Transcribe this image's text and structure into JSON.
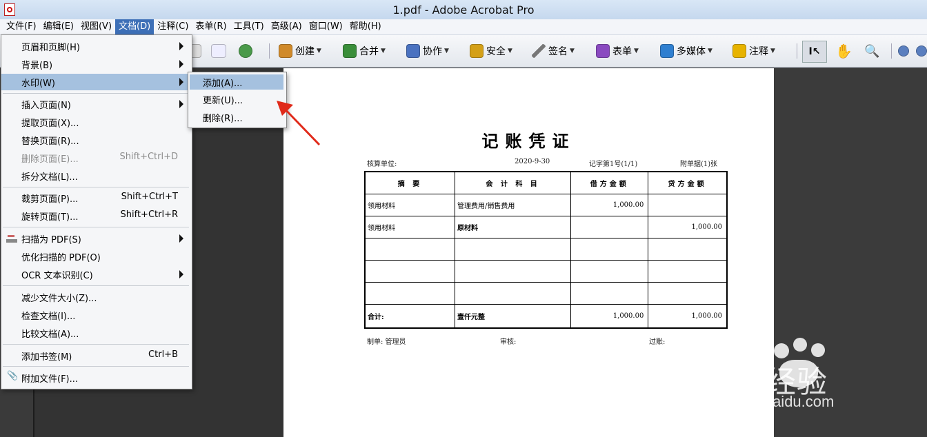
{
  "window": {
    "title": "1.pdf - Adobe Acrobat Pro"
  },
  "menubar": {
    "items": [
      "文件(F)",
      "编辑(E)",
      "视图(V)",
      "文档(D)",
      "注释(C)",
      "表单(R)",
      "工具(T)",
      "高级(A)",
      "窗口(W)",
      "帮助(H)"
    ],
    "active": "文档(D)"
  },
  "toolbar": {
    "buttons": [
      {
        "label": "创建",
        "icon": "create-pdf-icon",
        "color": "#d08a2a"
      },
      {
        "label": "合并",
        "icon": "combine-icon",
        "color": "#3a8e3a"
      },
      {
        "label": "协作",
        "icon": "collaborate-icon",
        "color": "#4a72c0"
      },
      {
        "label": "安全",
        "icon": "lock-icon",
        "color": "#d4a017"
      },
      {
        "label": "签名",
        "icon": "pen-icon",
        "color": "#6a6a6a"
      },
      {
        "label": "表单",
        "icon": "form-icon",
        "color": "#8a4ac0"
      },
      {
        "label": "多媒体",
        "icon": "multimedia-icon",
        "color": "#2f7fd0"
      },
      {
        "label": "注释",
        "icon": "comment-icon",
        "color": "#e7b300"
      }
    ]
  },
  "document_menu": {
    "items": [
      {
        "label": "页眉和页脚(H)",
        "shortcut": "",
        "submenu": true,
        "disabled": false
      },
      {
        "label": "背景(B)",
        "shortcut": "",
        "submenu": true,
        "disabled": false
      },
      {
        "label": "水印(W)",
        "shortcut": "",
        "submenu": true,
        "disabled": false
      },
      {
        "label": "插入页面(N)",
        "shortcut": "",
        "submenu": true,
        "disabled": false
      },
      {
        "label": "提取页面(X)...",
        "shortcut": "",
        "submenu": false,
        "disabled": false
      },
      {
        "label": "替换页面(R)...",
        "shortcut": "",
        "submenu": false,
        "disabled": false
      },
      {
        "label": "删除页面(E)...",
        "shortcut": "Shift+Ctrl+D",
        "submenu": false,
        "disabled": true
      },
      {
        "label": "拆分文档(L)...",
        "shortcut": "",
        "submenu": false,
        "disabled": false
      },
      {
        "label": "裁剪页面(P)...",
        "shortcut": "Shift+Ctrl+T",
        "submenu": false,
        "disabled": false
      },
      {
        "label": "旋转页面(T)...",
        "shortcut": "Shift+Ctrl+R",
        "submenu": false,
        "disabled": false
      },
      {
        "label": "扫描为 PDF(S)",
        "shortcut": "",
        "submenu": true,
        "disabled": false
      },
      {
        "label": "优化扫描的 PDF(O)",
        "shortcut": "",
        "submenu": false,
        "disabled": false
      },
      {
        "label": "OCR 文本识别(C)",
        "shortcut": "",
        "submenu": true,
        "disabled": false
      },
      {
        "label": "减少文件大小(Z)...",
        "shortcut": "",
        "submenu": false,
        "disabled": false
      },
      {
        "label": "检查文档(I)...",
        "shortcut": "",
        "submenu": false,
        "disabled": false
      },
      {
        "label": "比较文档(A)...",
        "shortcut": "",
        "submenu": false,
        "disabled": false
      },
      {
        "label": "添加书签(M)",
        "shortcut": "Ctrl+B",
        "submenu": false,
        "disabled": false
      },
      {
        "label": "附加文件(F)...",
        "shortcut": "",
        "submenu": false,
        "disabled": false
      }
    ],
    "highlighted": "水印(W)"
  },
  "watermark_submenu": {
    "items": [
      "添加(A)...",
      "更新(U)...",
      "删除(R)..."
    ],
    "highlighted": "添加(A)..."
  },
  "voucher": {
    "title": "记账凭证",
    "unit_label": "核算单位:",
    "date": "2020-9-30",
    "number": "记字第1号(1/1)",
    "attachments": "附单据(1)张",
    "headers": [
      "摘 要",
      "会 计 科 目",
      "借方金额",
      "贷方金额"
    ],
    "rows": [
      [
        "领用材料",
        "管理费用/销售费用",
        "1,000.00",
        ""
      ],
      [
        "领用材料",
        "原材料",
        "",
        "1,000.00"
      ],
      [
        "",
        "",
        "",
        ""
      ],
      [
        "",
        "",
        "",
        ""
      ],
      [
        "",
        "",
        "",
        ""
      ]
    ],
    "total_row": [
      "合计:",
      "壹仟元整",
      "1,000.00",
      "1,000.00"
    ],
    "maker": "制单: 管理员",
    "reviewer": "审核:",
    "poster": "过账:"
  },
  "watermark_logo": {
    "main": "Bai   经验",
    "sub": "jingyan.baidu.com"
  }
}
